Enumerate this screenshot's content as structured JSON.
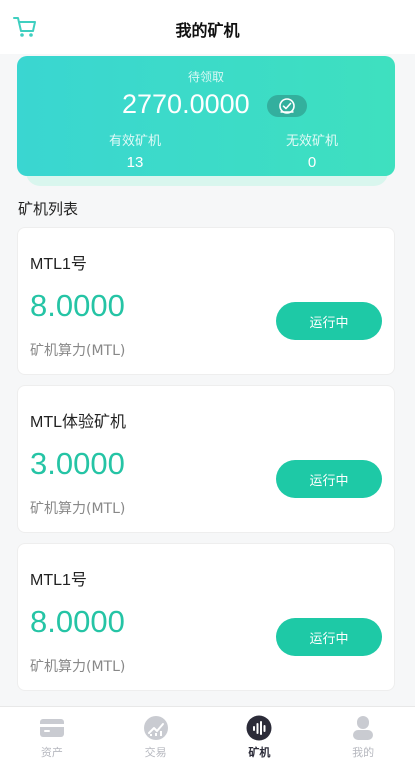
{
  "header": {
    "title": "我的矿机",
    "cart_icon": "cart-icon"
  },
  "summary": {
    "pending_label": "待领取",
    "pending_amount": "2770.0000",
    "claim_icon": "claim-icon",
    "valid_label": "有效矿机",
    "valid_count": "13",
    "invalid_label": "无效矿机",
    "invalid_count": "0"
  },
  "list": {
    "title": "矿机列表",
    "items": [
      {
        "name": "MTL1号",
        "power": "8.0000",
        "unit": "矿机算力(MTL)",
        "status": "运行中"
      },
      {
        "name": "MTL体验矿机",
        "power": "3.0000",
        "unit": "矿机算力(MTL)",
        "status": "运行中"
      },
      {
        "name": "MTL1号",
        "power": "8.0000",
        "unit": "矿机算力(MTL)",
        "status": "运行中"
      }
    ]
  },
  "tabbar": {
    "tabs": [
      {
        "label": "资产",
        "icon": "wallet-icon"
      },
      {
        "label": "交易",
        "icon": "chart-icon"
      },
      {
        "label": "矿机",
        "icon": "miner-icon"
      },
      {
        "label": "我的",
        "icon": "user-icon"
      }
    ],
    "active": "矿机"
  },
  "colors": {
    "accent": "#1ec9a6",
    "gradient_start": "#3ad6d1",
    "gradient_end": "#3ee0bf",
    "power_text": "#25c4a5"
  }
}
